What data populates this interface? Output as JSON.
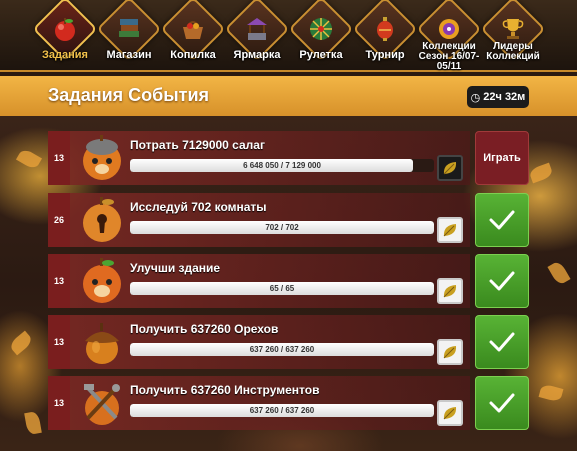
{
  "nav": {
    "items": [
      {
        "label": "Задания",
        "icon": "apple-icon",
        "active": true
      },
      {
        "label": "Магазин",
        "icon": "books-icon",
        "active": false
      },
      {
        "label": "Копилка",
        "icon": "basket-icon",
        "active": false
      },
      {
        "label": "Ярмарка",
        "icon": "well-icon",
        "active": false
      },
      {
        "label": "Рулетка",
        "icon": "roulette-icon",
        "active": false
      },
      {
        "label": "Турнир",
        "icon": "lantern-icon",
        "active": false
      },
      {
        "label": "Коллекции Сезон 16/07-05/11",
        "icon": "collection-icon",
        "active": false
      },
      {
        "label": "Лидеры Коллекций",
        "icon": "trophy-icon",
        "active": false
      }
    ]
  },
  "header": {
    "title": "Задания События",
    "timer": "22ч 32м"
  },
  "quests": [
    {
      "level": "13",
      "title": "Потрать 7129000 салаг",
      "progress_text": "6 648 050 / 7 129 000",
      "progress": 0.9325,
      "reward_style": "dark",
      "action": "play",
      "action_label": "Играть",
      "icon": "hamster-apple-icon"
    },
    {
      "level": "26",
      "title": "Исследуй 702 комнаты",
      "progress_text": "702 / 702",
      "progress": 1.0,
      "reward_style": "light",
      "action": "done",
      "action_label": "✓",
      "icon": "keyhole-apple-icon"
    },
    {
      "level": "13",
      "title": "Улучши здание",
      "progress_text": "65 / 65",
      "progress": 1.0,
      "reward_style": "light",
      "action": "done",
      "action_label": "✓",
      "icon": "hamster-apple-icon"
    },
    {
      "level": "13",
      "title": "Получить 637260 Орехов",
      "progress_text": "637 260 / 637 260",
      "progress": 1.0,
      "reward_style": "light",
      "action": "done",
      "action_label": "✓",
      "icon": "acorn-icon"
    },
    {
      "level": "13",
      "title": "Получить 637260 Инструментов",
      "progress_text": "637 260 / 637 260",
      "progress": 1.0,
      "reward_style": "light",
      "action": "done",
      "action_label": "✓",
      "icon": "tools-apple-icon"
    }
  ]
}
